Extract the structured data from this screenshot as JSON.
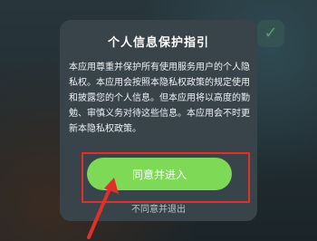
{
  "dialog": {
    "title": "个人信息保护指引",
    "body": "本应用尊重并保护所有使用服务用户的个人隐私权。本应用会按照本隐私权政策的规定使用和披露您的个人信息。但本应用将以高度的勤勉、审慎义务对待这些信息。本应用会不时更新本隐私权政策。",
    "agree_label": "同意并进入",
    "disagree_label": "不同意并退出"
  },
  "colors": {
    "accent_button": "#7ed957",
    "annotation_red": "#e0302a",
    "dialog_bg": "#38444a"
  },
  "icons": [
    "checkbox-icon",
    "annotation-arrow-icon"
  ]
}
